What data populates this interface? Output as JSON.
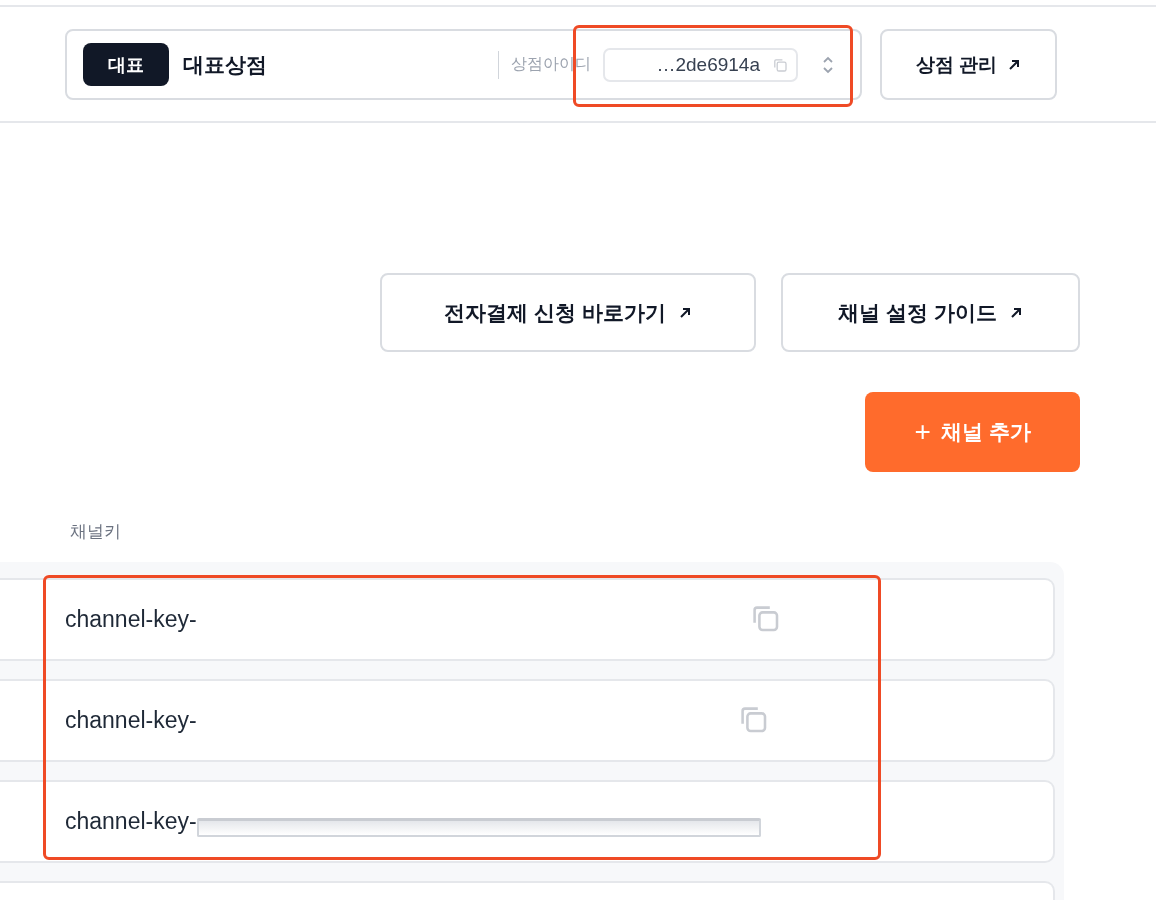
{
  "store_selector": {
    "badge": "대표",
    "store_name": "대표상점",
    "id_label": "상점아이디",
    "store_id": "…2de6914a",
    "highlighted": true
  },
  "manage_button": {
    "label": "상점 관리"
  },
  "link_buttons": [
    {
      "label": "전자결제 신청 바로가기"
    },
    {
      "label": "채널 설정 가이드"
    }
  ],
  "add_button": {
    "icon": "+",
    "label": "채널 추가"
  },
  "channel_table": {
    "column_label": "채널키",
    "highlighted": true,
    "rows": [
      {
        "kind": "copy",
        "key": "channel-key-"
      },
      {
        "kind": "copy",
        "key": "channel-key-"
      },
      {
        "kind": "masked",
        "key": "channel-key-"
      },
      {
        "kind": "empty"
      }
    ]
  }
}
